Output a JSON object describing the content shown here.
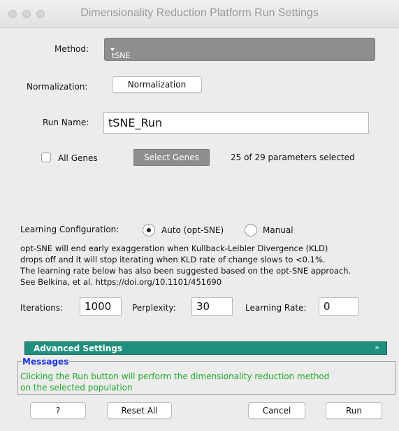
{
  "window": {
    "title": "Dimensionality Reduction Platform Run Settings"
  },
  "method": {
    "label": "Method:",
    "value": "tSNE"
  },
  "normalization": {
    "label": "Normalization:",
    "button": "Normalization"
  },
  "run_name": {
    "label": "Run Name:",
    "value": "tSNE_Run"
  },
  "genes": {
    "all_genes_label": "All Genes",
    "all_genes_checked": false,
    "select_button": "Select Genes",
    "status": "25 of 29 parameters selected"
  },
  "learning": {
    "label": "Learning Configuration:",
    "auto_label": "Auto (opt-SNE)",
    "manual_label": "Manual",
    "selected": "auto",
    "description": [
      "opt-SNE will end early exaggeration when Kullback-Leibler Divergence (KLD)",
      "drops off and it will stop iterating when KLD rate of change slows to <0.1%.",
      "The learning rate below has also been suggested based on the opt-SNE approach.",
      "See Belkina, et al. https://doi.org/10.1101/451690"
    ]
  },
  "params": {
    "iterations_label": "Iterations:",
    "iterations": "1000",
    "perplexity_label": "Perplexity:",
    "perplexity": "30",
    "learning_rate_label": "Learning Rate:",
    "learning_rate": "0"
  },
  "advanced": {
    "label": "Advanced Settings",
    "icon": "double-chevron-down-icon"
  },
  "messages": {
    "legend": "Messages",
    "lines": [
      "Clicking the Run button will perform the dimensionality reduction method",
      "on the selected population"
    ]
  },
  "buttons": {
    "help": "?",
    "reset": "Reset All",
    "cancel": "Cancel",
    "run": "Run"
  },
  "colors": {
    "accent_teal": "#1d8f7c",
    "message_blue": "#1b30e0",
    "message_green": "#1fa82c",
    "select_gray": "#8e8e8e"
  }
}
